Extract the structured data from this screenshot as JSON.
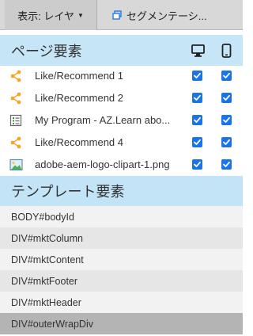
{
  "toolbar": {
    "view_label": "表示: レイヤ",
    "segmentation_label": "セグメンテーシ..."
  },
  "page_elements": {
    "title": "ページ要素",
    "devices": [
      "desktop-icon",
      "mobile-icon"
    ],
    "items": [
      {
        "label": "Like/Recommend 1",
        "icon": "share-icon",
        "desktop": true,
        "mobile": true
      },
      {
        "label": "Like/Recommend 2",
        "icon": "share-icon",
        "desktop": true,
        "mobile": true
      },
      {
        "label": "My Program - AZ.Learn abo...",
        "icon": "form-icon",
        "desktop": true,
        "mobile": true
      },
      {
        "label": "Like/Recommend 4",
        "icon": "share-icon",
        "desktop": true,
        "mobile": true
      },
      {
        "label": "adobe-aem-logo-clipart-1.png",
        "icon": "image-icon",
        "desktop": true,
        "mobile": true
      }
    ]
  },
  "template_elements": {
    "title": "テンプレート要素",
    "items": [
      {
        "label": "BODY#bodyId",
        "selected": false
      },
      {
        "label": "DIV#mktColumn",
        "selected": false
      },
      {
        "label": "DIV#mktContent",
        "selected": false
      },
      {
        "label": "DIV#mktFooter",
        "selected": false
      },
      {
        "label": "DIV#mktHeader",
        "selected": false
      },
      {
        "label": "DIV#outerWrapDiv",
        "selected": true
      }
    ]
  },
  "colors": {
    "section_header_bg": "#c6e6f7",
    "checkbox": "#1a73e8",
    "share_icon": "#f5a623",
    "selected_row": "#b4b4b4"
  }
}
